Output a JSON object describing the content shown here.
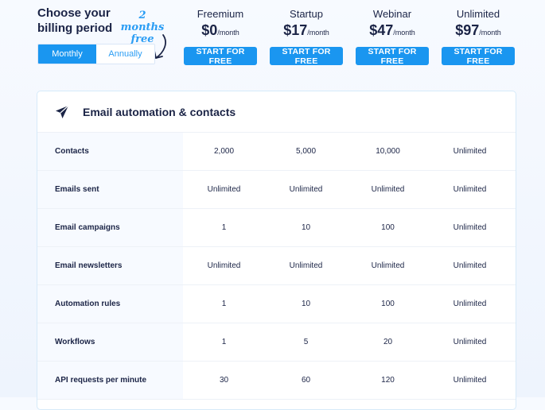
{
  "billing": {
    "title": "Choose your billing period",
    "promo": "2 months free",
    "options": [
      "Monthly",
      "Annually"
    ],
    "selected": "Monthly"
  },
  "plans": [
    {
      "name": "Freemium",
      "price": "$0",
      "period": "/month",
      "cta": "START FOR FREE"
    },
    {
      "name": "Startup",
      "price": "$17",
      "period": "/month",
      "cta": "START FOR FREE"
    },
    {
      "name": "Webinar",
      "price": "$47",
      "period": "/month",
      "cta": "START FOR FREE"
    },
    {
      "name": "Unlimited",
      "price": "$97",
      "period": "/month",
      "cta": "START FOR FREE"
    }
  ],
  "section": {
    "icon": "paper-plane-icon",
    "title": "Email automation & contacts",
    "rows": [
      {
        "label": "Contacts",
        "values": [
          "2,000",
          "5,000",
          "10,000",
          "Unlimited"
        ]
      },
      {
        "label": "Emails sent",
        "values": [
          "Unlimited",
          "Unlimited",
          "Unlimited",
          "Unlimited"
        ]
      },
      {
        "label": "Email campaigns",
        "values": [
          "1",
          "10",
          "100",
          "Unlimited"
        ]
      },
      {
        "label": "Email newsletters",
        "values": [
          "Unlimited",
          "Unlimited",
          "Unlimited",
          "Unlimited"
        ]
      },
      {
        "label": "Automation rules",
        "values": [
          "1",
          "10",
          "100",
          "Unlimited"
        ]
      },
      {
        "label": "Workflows",
        "values": [
          "1",
          "5",
          "20",
          "Unlimited"
        ]
      },
      {
        "label": "API requests per minute",
        "values": [
          "30",
          "60",
          "120",
          "Unlimited"
        ]
      }
    ]
  },
  "colors": {
    "accent": "#1a96f0",
    "text": "#1b2446",
    "promo": "#2a9df4"
  }
}
